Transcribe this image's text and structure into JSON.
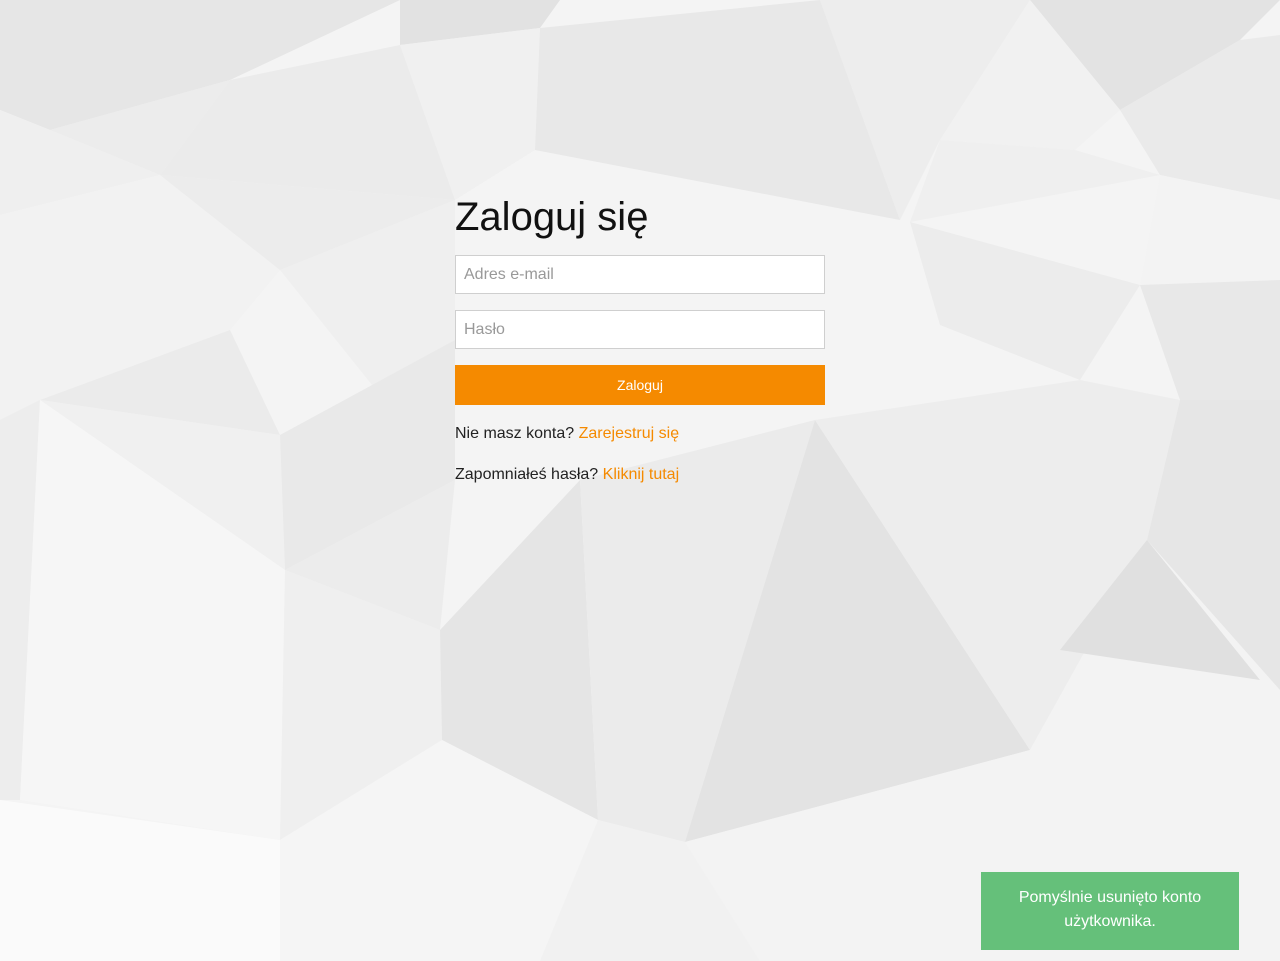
{
  "login": {
    "title": "Zaloguj się",
    "email_placeholder": "Adres e-mail",
    "password_placeholder": "Hasło",
    "submit_label": "Zaloguj",
    "register_prompt": "Nie masz konta?",
    "register_link": "Zarejestruj się",
    "forgot_prompt": "Zapomniałeś hasła?",
    "forgot_link": "Kliknij tutaj"
  },
  "notification": {
    "message": "Pomyślnie usunięto konto użytkownika."
  },
  "colors": {
    "accent": "#f58a00",
    "success": "#65c07a",
    "background": "#f3f3f3"
  }
}
